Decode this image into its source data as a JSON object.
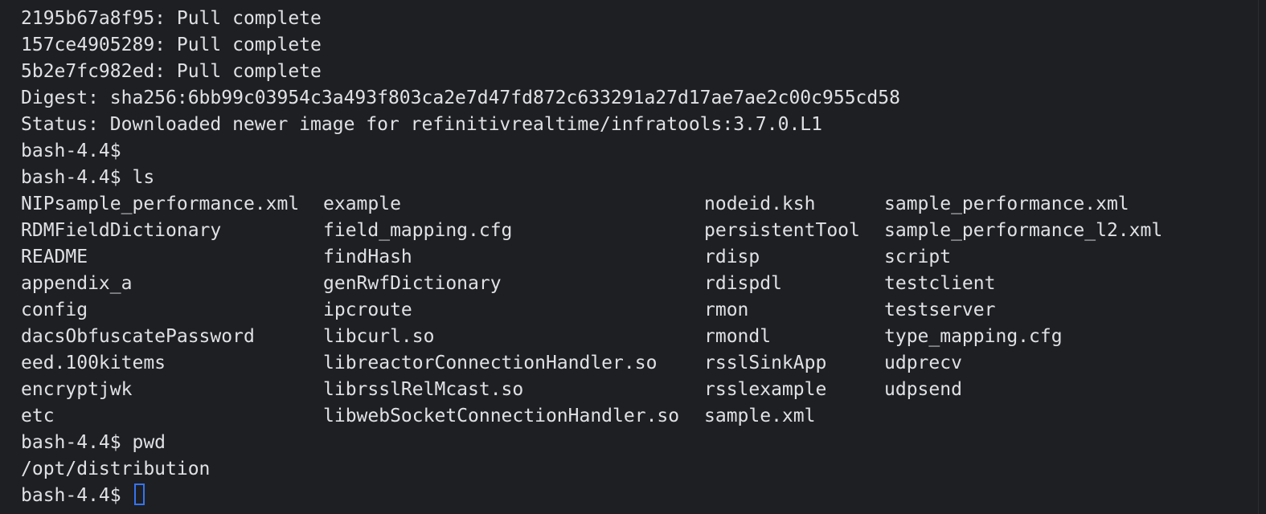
{
  "colors": {
    "background": "#1e1f22",
    "text": "#dfe1e5",
    "cursor": "#3574f0"
  },
  "terminal": {
    "pre_lines": [
      "2195b67a8f95: Pull complete",
      "157ce4905289: Pull complete",
      "5b2e7fc982ed: Pull complete",
      "Digest: sha256:6bb99c03954c3a493f803ca2e7d47fd872c633291a27d17ae7ae2c00c955cd58",
      "Status: Downloaded newer image for refinitivrealtime/infratools:3.7.0.L1",
      "bash-4.4$",
      "bash-4.4$ ls"
    ],
    "ls_rows": [
      [
        "NIPsample_performance.xml",
        "example",
        "nodeid.ksh",
        "sample_performance.xml"
      ],
      [
        "RDMFieldDictionary",
        "field_mapping.cfg",
        "persistentTool",
        "sample_performance_l2.xml"
      ],
      [
        "README",
        "findHash",
        "rdisp",
        "script"
      ],
      [
        "appendix_a",
        "genRwfDictionary",
        "rdispdl",
        "testclient"
      ],
      [
        "config",
        "ipcroute",
        "rmon",
        "testserver"
      ],
      [
        "dacsObfuscatePassword",
        "libcurl.so",
        "rmondl",
        "type_mapping.cfg"
      ],
      [
        "eed.100kitems",
        "libreactorConnectionHandler.so",
        "rsslSinkApp",
        "udprecv"
      ],
      [
        "encryptjwk",
        "librsslRelMcast.so",
        "rsslexample",
        "udpsend"
      ],
      [
        "etc",
        "libwebSocketConnectionHandler.so",
        "sample.xml",
        ""
      ]
    ],
    "post_lines": [
      "bash-4.4$ pwd",
      "/opt/distribution"
    ],
    "prompt": "bash-4.4$ "
  }
}
